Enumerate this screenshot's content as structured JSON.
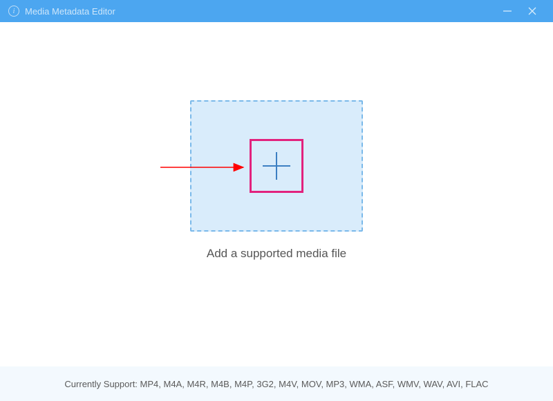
{
  "window": {
    "title": "Media Metadata Editor"
  },
  "main": {
    "hint": "Add a supported media file"
  },
  "footer": {
    "label": "Currently Support: ",
    "formats": "MP4, M4A, M4R, M4B, M4P, 3G2, M4V, MOV, MP3, WMA, ASF, WMV, WAV, AVI, FLAC"
  },
  "annotation": {
    "highlight": "add-button-highlight"
  }
}
